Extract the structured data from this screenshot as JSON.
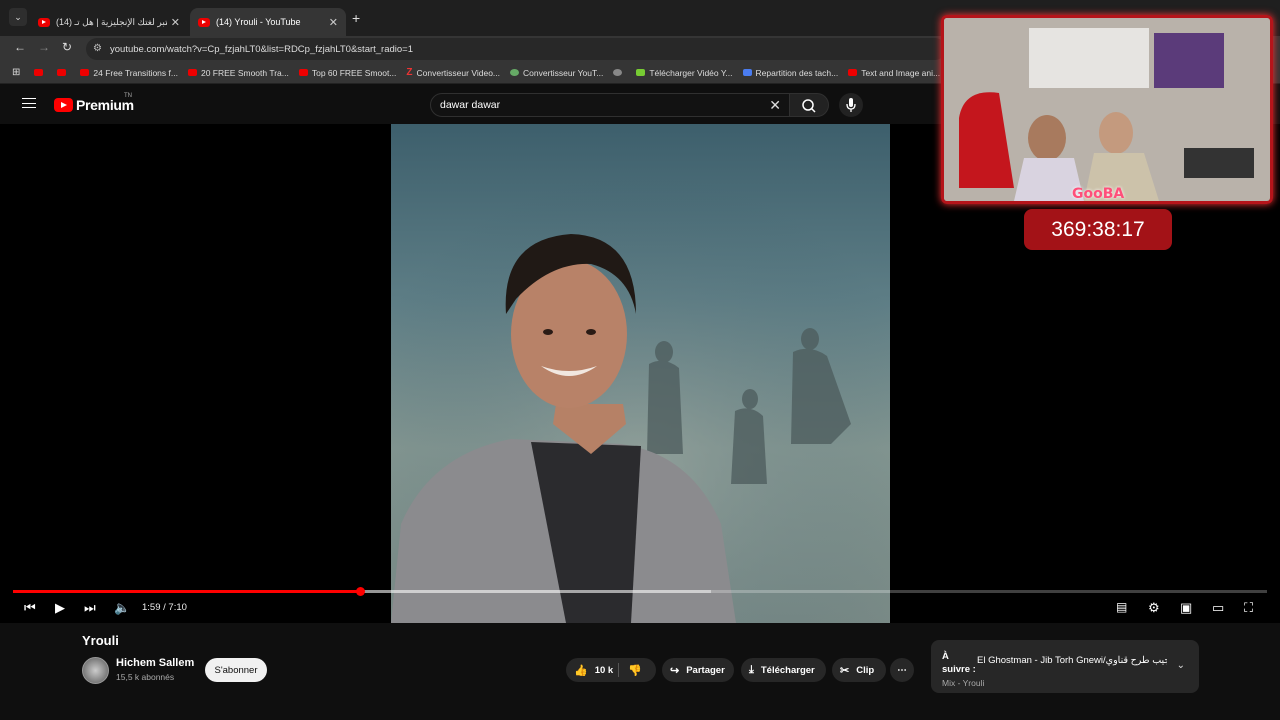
{
  "browser": {
    "tabs": [
      {
        "title": "(14) اختبر لغتك الإنجليزية | هل تـ..."
      },
      {
        "title": "(14) Yrouli - YouTube"
      }
    ],
    "address": "youtube.com/watch?v=Cp_fzjahLT0&list=RDCp_fzjahLT0&start_radio=1",
    "bookmarks": [
      {
        "label": "",
        "icon": "youtube-icon"
      },
      {
        "label": "",
        "icon": "youtube-icon"
      },
      {
        "label": "24 Free Transitions f...",
        "icon": "youtube-icon"
      },
      {
        "label": "20 FREE Smooth Tra...",
        "icon": "youtube-icon"
      },
      {
        "label": "Top 60 FREE Smoot...",
        "icon": "youtube-icon"
      },
      {
        "label": "Convertisseur Video...",
        "icon": "z-icon"
      },
      {
        "label": "Convertisseur YouT...",
        "icon": "converter-icon"
      },
      {
        "label": "",
        "icon": "globe-icon"
      },
      {
        "label": "Télécharger Vidéo Y...",
        "icon": "download-icon"
      },
      {
        "label": "Repartition des tach...",
        "icon": "docs-icon"
      },
      {
        "label": "Text and Image ani...",
        "icon": "youtube-icon"
      }
    ]
  },
  "youtube": {
    "logo_word": "Premium",
    "logo_tm": "TN",
    "search_value": "dawar dawar"
  },
  "player": {
    "time": "1:59 / 7:10",
    "progress_fraction": 0.277,
    "buffer_fraction": 0.557
  },
  "overlay": {
    "cam_label": "GooBA",
    "timer": "369:38:17"
  },
  "video": {
    "title": "Yrouli",
    "channel": "Hichem Sallem",
    "subscribers": "15,5 k abonnés",
    "subscribe_label": "S'abonner",
    "likes": "10 k",
    "share_label": "Partager",
    "download_label": "Télécharger",
    "clip_label": "Clip"
  },
  "up_next": {
    "label": "À suivre :",
    "song": "El Ghostman - Jib Torh Gnewi/جيب طرح قناوي...",
    "source": "Mix - Yrouli"
  }
}
